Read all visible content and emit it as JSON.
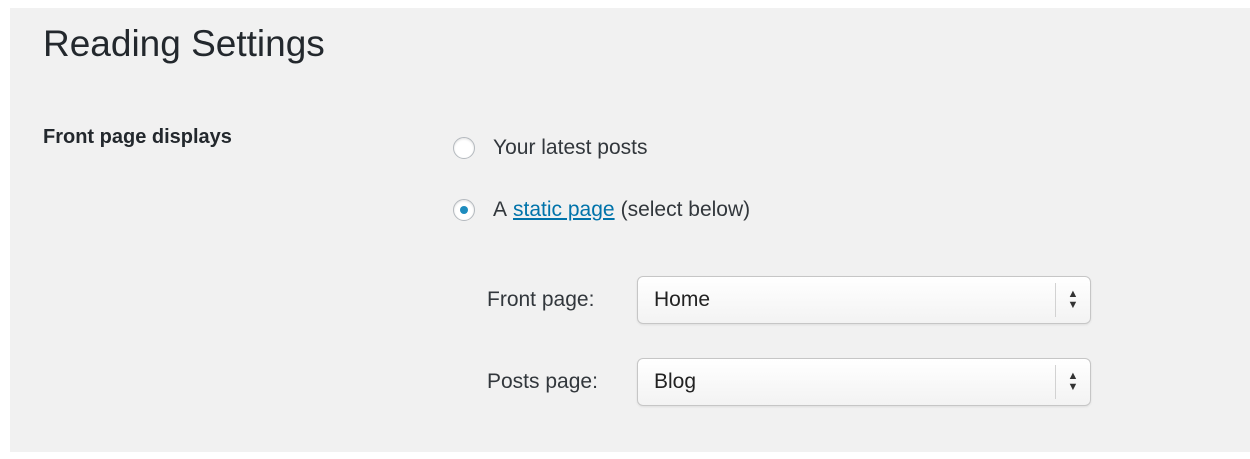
{
  "page": {
    "title": "Reading Settings"
  },
  "front_page_displays": {
    "label": "Front page displays",
    "option_latest": "Your latest posts",
    "option_static_prefix": "A",
    "option_static_link": "static page",
    "option_static_suffix": "(select below)",
    "selected": "static"
  },
  "selects": {
    "front_page": {
      "label": "Front page:",
      "value": "Home"
    },
    "posts_page": {
      "label": "Posts page:",
      "value": "Blog"
    }
  },
  "colors": {
    "link": "#0073aa",
    "radio_dot": "#1e8cbe",
    "panel_bg": "#f1f1f1"
  },
  "icons": {
    "select_arrows": "up-down-arrows-icon"
  }
}
